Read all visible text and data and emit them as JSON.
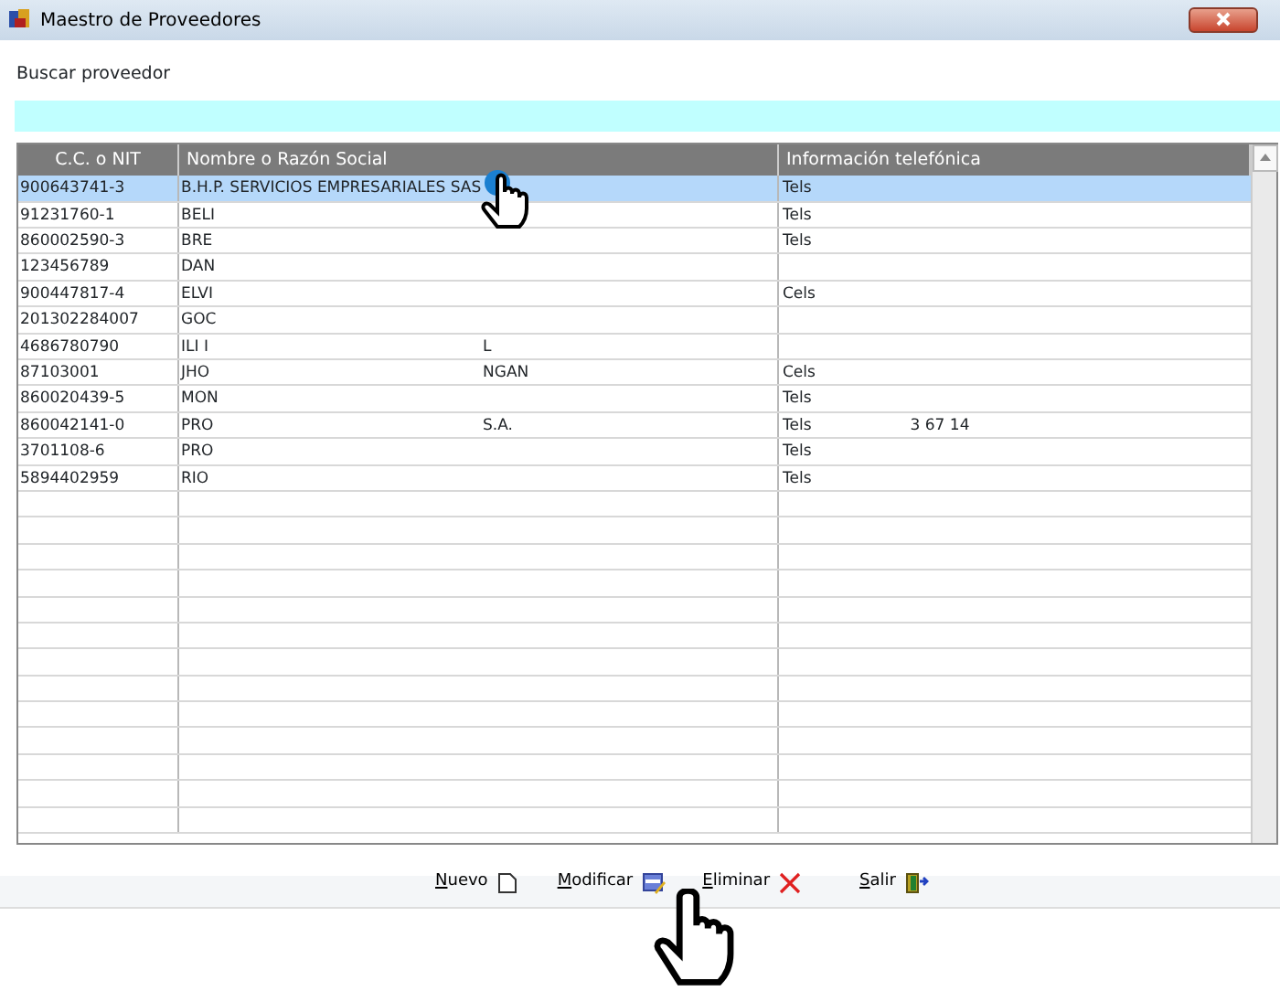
{
  "window": {
    "title": "Maestro de Proveedores"
  },
  "search": {
    "label": "Buscar proveedor"
  },
  "table": {
    "columns": [
      "C.C. o NIT",
      "Nombre o Razón Social",
      "Información telefónica"
    ],
    "rows": [
      {
        "id": "900643741-3",
        "name": "B.H.P. SERVICIOS EMPRESARIALES SAS",
        "phone": "Tels",
        "selected": true
      },
      {
        "id": "91231760-1",
        "name": "BELI",
        "phone": "Tels",
        "selected": false
      },
      {
        "id": "860002590-3",
        "name": "BRE",
        "phone": "Tels",
        "selected": false
      },
      {
        "id": "123456789",
        "name": "DAN",
        "selected": false
      },
      {
        "id": "900447817-4",
        "name": "ELVI",
        "phone": "Cels",
        "selected": false
      },
      {
        "id": "201302284007",
        "name": "GOC",
        "selected": false
      },
      {
        "id": "4686780790",
        "name": "ILI I",
        "name_tail": "L",
        "selected": false
      },
      {
        "id": "87103001",
        "name": "JHO",
        "name_tail": "NGAN",
        "phone": "Cels",
        "selected": false
      },
      {
        "id": "860020439-5",
        "name": "MON",
        "phone": "Tels",
        "selected": false
      },
      {
        "id": "860042141-0",
        "name": "PRO",
        "name_tail": "S.A.",
        "phone": "Tels",
        "phone_tail": "3 67 14",
        "selected": false
      },
      {
        "id": "3701108-6",
        "name": "PRO",
        "phone": "Tels",
        "selected": false
      },
      {
        "id": "5894402959",
        "name": "RIO",
        "phone": "Tels",
        "selected": false
      }
    ]
  },
  "buttons": [
    {
      "label": "Nuevo",
      "kind": "new"
    },
    {
      "label": "Modificar",
      "kind": "edit"
    },
    {
      "label": "Eliminar",
      "kind": "delete"
    },
    {
      "label": "Salir",
      "kind": "exit"
    }
  ]
}
